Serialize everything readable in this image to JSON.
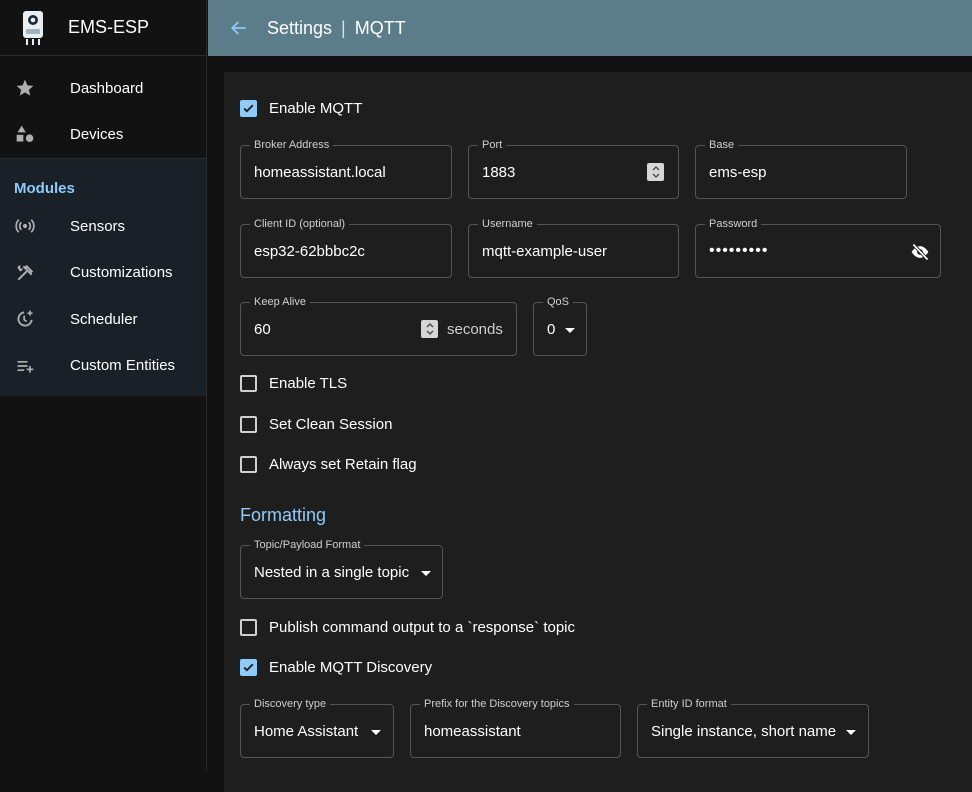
{
  "app": {
    "title": "EMS-ESP"
  },
  "nav": {
    "main": [
      {
        "label": "Dashboard",
        "icon": "star-icon"
      },
      {
        "label": "Devices",
        "icon": "shapes-icon"
      }
    ],
    "modules_header": "Modules",
    "modules": [
      {
        "label": "Sensors",
        "icon": "sensors-icon"
      },
      {
        "label": "Customizations",
        "icon": "tools-icon"
      },
      {
        "label": "Scheduler",
        "icon": "scheduler-icon"
      },
      {
        "label": "Custom Entities",
        "icon": "playlist-add-icon"
      }
    ]
  },
  "header": {
    "section": "Settings",
    "separator": "|",
    "page": "MQTT"
  },
  "form": {
    "enable_mqtt": {
      "label": "Enable MQTT",
      "checked": true
    },
    "broker": {
      "label": "Broker Address",
      "value": "homeassistant.local"
    },
    "port": {
      "label": "Port",
      "value": "1883"
    },
    "base": {
      "label": "Base",
      "value": "ems-esp"
    },
    "client_id": {
      "label": "Client ID (optional)",
      "value": "esp32-62bbbc2c"
    },
    "username": {
      "label": "Username",
      "value": "mqtt-example-user"
    },
    "password": {
      "label": "Password",
      "value": "•••••••••"
    },
    "keep_alive": {
      "label": "Keep Alive",
      "value": "60",
      "unit": "seconds"
    },
    "qos": {
      "label": "QoS",
      "value": "0"
    },
    "enable_tls": {
      "label": "Enable TLS",
      "checked": false
    },
    "clean_session": {
      "label": "Set Clean Session",
      "checked": false
    },
    "retain": {
      "label": "Always set Retain flag",
      "checked": false
    },
    "formatting_title": "Formatting",
    "topic_format": {
      "label": "Topic/Payload Format",
      "value": "Nested in a single topic"
    },
    "publish_response": {
      "label": "Publish command output to a `response` topic",
      "checked": false
    },
    "discovery": {
      "label": "Enable MQTT Discovery",
      "checked": true
    },
    "discovery_type": {
      "label": "Discovery type",
      "value": "Home Assistant"
    },
    "discovery_prefix": {
      "label": "Prefix for the Discovery topics",
      "value": "homeassistant"
    },
    "entity_format": {
      "label": "Entity ID format",
      "value": "Single instance, short name"
    }
  },
  "colors": {
    "accent": "#90caf9",
    "appbar": "#5b7d89",
    "panel": "#1e1e1e",
    "sidebar": "#121212"
  }
}
